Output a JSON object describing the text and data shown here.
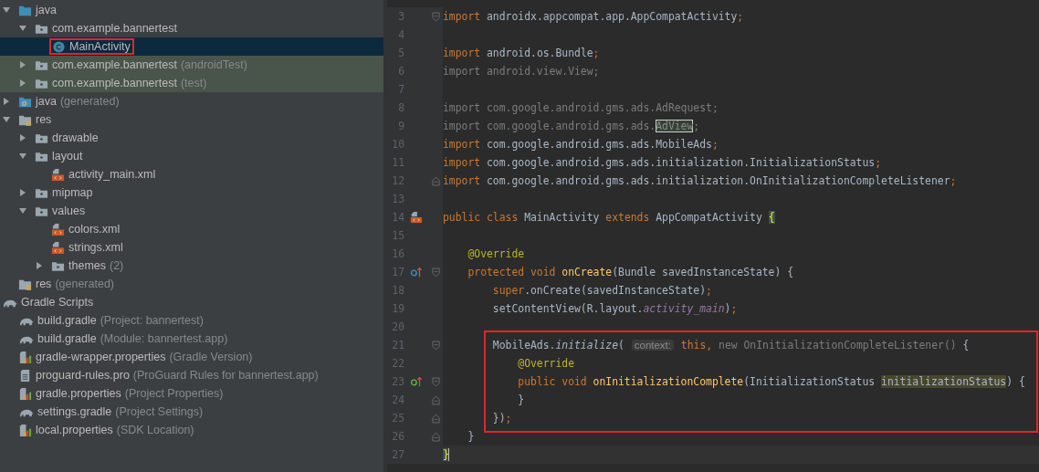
{
  "project_tree": [
    {
      "label": "java",
      "kind": "source-folder",
      "expanded": true,
      "selected": false,
      "children": [
        {
          "label": "com.example.bannertest",
          "kind": "package",
          "expanded": true,
          "selected": false,
          "children": [
            {
              "label": "MainActivity",
              "kind": "class",
              "selected": true,
              "boxed": true
            }
          ]
        },
        {
          "label": "com.example.bannertest",
          "suffix": "(androidTest)",
          "kind": "package",
          "expanded": false,
          "selected": false,
          "test_scope": true
        },
        {
          "label": "com.example.bannertest",
          "suffix": "(test)",
          "kind": "package",
          "expanded": false,
          "selected": false,
          "test_scope": true
        }
      ]
    },
    {
      "label": "java",
      "suffix": "(generated)",
      "kind": "generated-folder",
      "expanded": false,
      "selected": false
    },
    {
      "label": "res",
      "kind": "res-folder",
      "expanded": true,
      "selected": false,
      "children": [
        {
          "label": "drawable",
          "kind": "package",
          "expanded": false,
          "selected": false
        },
        {
          "label": "layout",
          "kind": "package",
          "expanded": true,
          "selected": false,
          "children": [
            {
              "label": "activity_main.xml",
              "kind": "xml",
              "selected": false
            }
          ]
        },
        {
          "label": "mipmap",
          "kind": "package",
          "expanded": false,
          "selected": false
        },
        {
          "label": "values",
          "kind": "package",
          "expanded": true,
          "selected": false,
          "children": [
            {
              "label": "colors.xml",
              "kind": "xml",
              "selected": false
            },
            {
              "label": "strings.xml",
              "kind": "xml",
              "selected": false
            },
            {
              "label": "themes",
              "suffix": "(2)",
              "kind": "package",
              "expanded": false,
              "selected": false
            }
          ]
        }
      ]
    },
    {
      "label": "res",
      "suffix": "(generated)",
      "kind": "res-folder",
      "selected": false
    },
    {
      "label": "Gradle Scripts",
      "kind": "gradle",
      "selected": false,
      "children": [
        {
          "label": "build.gradle",
          "suffix": "(Project: bannertest)",
          "kind": "gradle",
          "selected": false
        },
        {
          "label": "build.gradle",
          "suffix": "(Module: bannertest.app)",
          "kind": "gradle",
          "selected": false
        },
        {
          "label": "gradle-wrapper.properties",
          "suffix": "(Gradle Version)",
          "kind": "properties",
          "selected": false
        },
        {
          "label": "proguard-rules.pro",
          "suffix": "(ProGuard Rules for bannertest.app)",
          "kind": "text-file",
          "selected": false
        },
        {
          "label": "gradle.properties",
          "suffix": "(Project Properties)",
          "kind": "properties",
          "selected": false
        },
        {
          "label": "settings.gradle",
          "suffix": "(Project Settings)",
          "kind": "gradle",
          "selected": false
        },
        {
          "label": "local.properties",
          "suffix": "(SDK Location)",
          "kind": "properties",
          "selected": false
        }
      ]
    }
  ],
  "editor": {
    "lines": [
      {
        "number": "3",
        "expanded": true,
        "tokens": [
          {
            "kind": "keyword",
            "text": "import"
          },
          {
            "kind": "plain",
            "text": " androidx.appcompat.app.AppCompatActivity"
          },
          {
            "kind": "keyword",
            "text": ";"
          }
        ]
      },
      {
        "number": "4"
      },
      {
        "number": "5",
        "tokens": [
          {
            "kind": "keyword",
            "text": "import"
          },
          {
            "kind": "plain",
            "text": " android.os.Bundle"
          },
          {
            "kind": "keyword",
            "text": ";"
          }
        ]
      },
      {
        "number": "6",
        "tokens": [
          {
            "kind": "unused",
            "text": "import android.view.View;"
          }
        ]
      },
      {
        "number": "7"
      },
      {
        "number": "8",
        "tokens": [
          {
            "kind": "unused",
            "text": "import com.google.android.gms.ads.AdRequest;"
          }
        ]
      },
      {
        "number": "9",
        "tokens": [
          {
            "kind": "unused",
            "text": "import com.google.android.gms.ads."
          },
          {
            "kind": "match",
            "text": "AdView"
          },
          {
            "kind": "unused",
            "text": ";"
          }
        ]
      },
      {
        "number": "10",
        "tokens": [
          {
            "kind": "keyword",
            "text": "import"
          },
          {
            "kind": "plain",
            "text": " com.google.android.gms.ads.MobileAds"
          },
          {
            "kind": "keyword",
            "text": ";"
          }
        ]
      },
      {
        "number": "11",
        "tokens": [
          {
            "kind": "keyword",
            "text": "import"
          },
          {
            "kind": "plain",
            "text": " com.google.android.gms.ads.initialization.InitializationStatus"
          },
          {
            "kind": "keyword",
            "text": ";"
          }
        ]
      },
      {
        "number": "12",
        "fold_end": true,
        "tokens": [
          {
            "kind": "keyword",
            "text": "import"
          },
          {
            "kind": "plain",
            "text": " com.google.android.gms.ads.initialization.OnInitializationCompleteListener"
          },
          {
            "kind": "keyword",
            "text": ";"
          }
        ]
      },
      {
        "number": "13"
      },
      {
        "number": "14",
        "kind": "layout",
        "tokens": [
          {
            "kind": "keyword",
            "text": "public class "
          },
          {
            "kind": "plain",
            "text": "MainActivity "
          },
          {
            "kind": "keyword",
            "text": "extends "
          },
          {
            "kind": "plain",
            "text": "AppCompatActivity "
          },
          {
            "kind": "brace",
            "text": "{"
          }
        ]
      },
      {
        "number": "15"
      },
      {
        "number": "16",
        "tokens": [
          {
            "kind": "annotation",
            "text": "    @Override"
          }
        ]
      },
      {
        "number": "17",
        "kind": "overrides",
        "expanded": true,
        "tokens": [
          {
            "kind": "keyword",
            "text": "    protected void "
          },
          {
            "kind": "method",
            "text": "onCreate"
          },
          {
            "kind": "plain",
            "text": "(Bundle savedInstanceState) {"
          }
        ]
      },
      {
        "number": "18",
        "tokens": [
          {
            "kind": "keyword",
            "text": "        super"
          },
          {
            "kind": "plain",
            "text": ".onCreate(savedInstanceState)"
          },
          {
            "kind": "keyword",
            "text": ";"
          }
        ]
      },
      {
        "number": "19",
        "tokens": [
          {
            "kind": "plain",
            "text": "        setContentView(R.layout."
          },
          {
            "kind": "field",
            "text": "activity_main"
          },
          {
            "kind": "plain",
            "text": ")"
          },
          {
            "kind": "keyword",
            "text": ";"
          }
        ]
      },
      {
        "number": "20"
      },
      {
        "number": "21",
        "expanded": true,
        "boxed": true,
        "tokens": [
          {
            "kind": "plain",
            "text": "        MobileAds."
          },
          {
            "kind": "static",
            "text": "initialize"
          },
          {
            "kind": "plain",
            "text": "( "
          },
          {
            "kind": "hint",
            "text": "context:"
          },
          {
            "kind": "keyword",
            "text": " this, "
          },
          {
            "kind": "unused",
            "text": "new OnInitializationCompleteListener()"
          },
          {
            "kind": "plain",
            "text": " {"
          }
        ]
      },
      {
        "number": "22",
        "boxed": true,
        "tokens": [
          {
            "kind": "annotation",
            "text": "            @Override"
          }
        ]
      },
      {
        "number": "23",
        "kind": "implements",
        "expanded": true,
        "boxed": true,
        "tokens": [
          {
            "kind": "keyword",
            "text": "            public void "
          },
          {
            "kind": "method",
            "text": "onInitializationComplete"
          },
          {
            "kind": "plain",
            "text": "(InitializationStatus "
          },
          {
            "kind": "param",
            "text": "initializationStatus"
          },
          {
            "kind": "plain",
            "text": ") {"
          }
        ]
      },
      {
        "number": "24",
        "fold_end": true,
        "boxed": true,
        "tokens": [
          {
            "kind": "plain",
            "text": "            }"
          }
        ]
      },
      {
        "number": "25",
        "fold_end": true,
        "boxed": true,
        "tokens": [
          {
            "kind": "plain",
            "text": "        })"
          },
          {
            "kind": "keyword",
            "text": ";"
          }
        ]
      },
      {
        "number": "26",
        "fold_end": true,
        "tokens": [
          {
            "kind": "plain",
            "text": "    }"
          }
        ]
      },
      {
        "number": "27",
        "current": true,
        "tokens": [
          {
            "kind": "brace",
            "text": "}"
          }
        ]
      }
    ]
  }
}
